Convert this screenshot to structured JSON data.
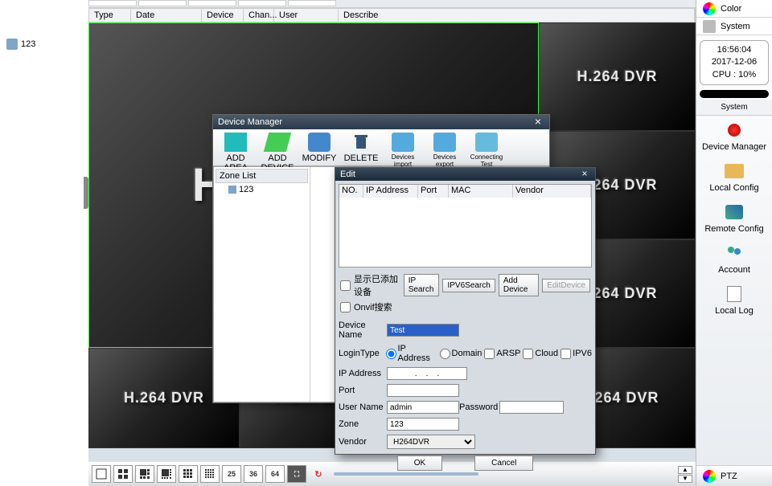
{
  "left_tree": {
    "node1": "123"
  },
  "table_headers": {
    "type": "Type",
    "date": "Date",
    "device": "Device",
    "chan": "Chan...",
    "user": "User",
    "desc": "Describe"
  },
  "watermark": "H.264 DVR",
  "right": {
    "color": "Color",
    "system_btn": "System",
    "clock_time": "16:56:04",
    "clock_date": "2017-12-06",
    "clock_cpu": "CPU : 10%",
    "section": "System",
    "dm": "Device Manager",
    "lc": "Local Config",
    "rc": "Remote Config",
    "acc": "Account",
    "log": "Local Log",
    "ptz": "PTZ"
  },
  "grid_nums": {
    "n25": "25",
    "n36": "36",
    "n64": "64"
  },
  "dm": {
    "title": "Device Manager",
    "tb": {
      "addarea": "ADD AREA",
      "adddev": "ADD DEVICE",
      "modify": "MODIFY",
      "delete": "DELETE",
      "import": "Devices import",
      "export": "Devices export",
      "test": "Connecting Test"
    },
    "zone_list": "Zone List",
    "zone_item": "123"
  },
  "edit": {
    "title": "Edit",
    "cols": {
      "no": "NO.",
      "ip": "IP Address",
      "port": "Port",
      "mac": "MAC",
      "vendor": "Vendor"
    },
    "show_added": "显示已添加设备",
    "ip_search": "IP Search",
    "ipv6_search": "IPV6Search",
    "add_device": "Add Device",
    "edit_device": "EditDevice",
    "onvif": "Onvif搜索",
    "labels": {
      "devname": "Device Name",
      "logintype": "LoginType",
      "ipaddr": "IP Address",
      "port": "Port",
      "username": "User Name",
      "password": "Password",
      "zone": "Zone",
      "vendor": "Vendor"
    },
    "login_opts": {
      "ip": "IP Address",
      "domain": "Domain",
      "arsp": "ARSP",
      "cloud": "Cloud",
      "ipv6": "IPV6"
    },
    "vals": {
      "devname": "Test",
      "username": "admin",
      "zone": "123",
      "vendor": "H264DVR",
      "ipaddr": "   .    .    .   "
    },
    "ok": "OK",
    "cancel": "Cancel"
  }
}
